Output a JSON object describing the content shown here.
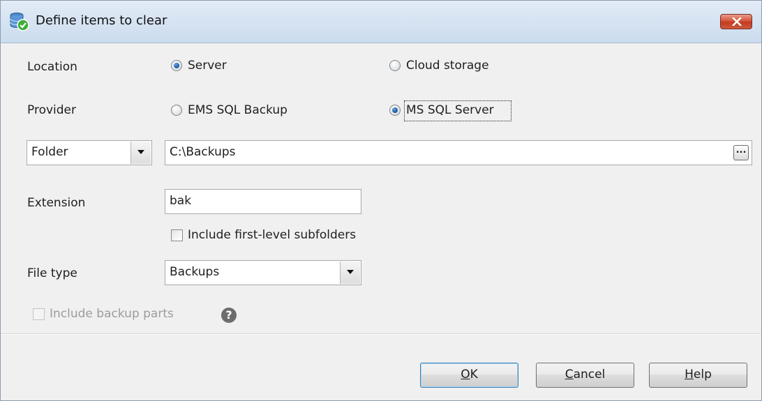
{
  "window": {
    "title": "Define items to clear",
    "icon": "database-clear-icon",
    "close_icon": "close-icon"
  },
  "location": {
    "label": "Location",
    "options": [
      {
        "label": "Server",
        "checked": true
      },
      {
        "label": "Cloud storage",
        "checked": false
      }
    ]
  },
  "provider": {
    "label": "Provider",
    "options": [
      {
        "label": "EMS SQL Backup",
        "checked": false
      },
      {
        "label": "MS SQL Server",
        "checked": true
      }
    ]
  },
  "folder": {
    "type_value": "Folder",
    "path_value": "C:\\Backups",
    "browse_label": "..."
  },
  "extension": {
    "label": "Extension",
    "value": "bak"
  },
  "subfolders": {
    "label": "Include first-level subfolders",
    "checked": false
  },
  "file_type": {
    "label": "File type",
    "value": "Backups"
  },
  "backup_parts": {
    "label": "Include backup parts",
    "checked": false,
    "enabled": false,
    "help_glyph": "?"
  },
  "buttons": {
    "ok": {
      "mnemonic": "O",
      "rest": "K"
    },
    "cancel": {
      "mnemonic": "C",
      "rest": "ancel"
    },
    "help": {
      "mnemonic": "H",
      "rest": "elp"
    }
  },
  "colors": {
    "title_bar": "#d6e3f2",
    "close_button": "#c13b22",
    "radio_selected": "#1f5fae",
    "disabled_text": "#9c9c9c"
  }
}
